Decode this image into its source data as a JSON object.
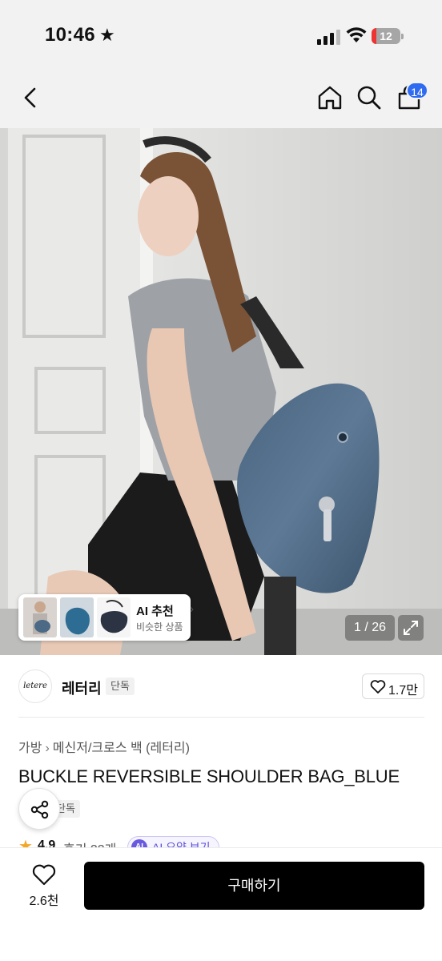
{
  "status_bar": {
    "time": "10:46",
    "battery": "12"
  },
  "nav": {
    "cart_badge": "14"
  },
  "icons": {
    "back": "back-icon",
    "home": "home-icon",
    "search": "search-icon",
    "cart": "cart-icon",
    "heart": "heart-icon",
    "share": "share-icon",
    "expand": "expand-icon",
    "star": "star-icon"
  },
  "hero": {
    "ai_recommend": {
      "title": "AI 추천",
      "subtitle": "비슷한 상품"
    },
    "page_indicator": "1 / 26"
  },
  "brand": {
    "logo_text": "letere",
    "name": "레터리",
    "badge": "단독",
    "likes": "1.7만"
  },
  "breadcrumb": {
    "level1": "가방",
    "level2": "메신저/크로스 백 (레터리)"
  },
  "product": {
    "title": "BUCKLE REVERSIBLE SHOULDER BAG_BLUE",
    "tag": "단독"
  },
  "rating": {
    "score": "4.9",
    "reviews": "후기 22개",
    "ai_summary": "AI 요약 보기"
  },
  "bottom": {
    "wish_count": "2.6천",
    "buy_label": "구매하기"
  },
  "colors": {
    "buy_button": "#000000",
    "cart_badge": "#2f6bf0",
    "rating_star": "#f5a623",
    "ai_accent": "#6a5ae0"
  }
}
